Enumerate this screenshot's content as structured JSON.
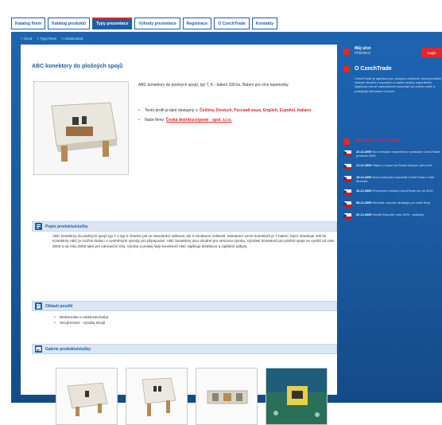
{
  "nav": {
    "tabs": [
      {
        "label": "Katalog firem",
        "active": false
      },
      {
        "label": "Katalog produktů",
        "active": false
      },
      {
        "label": "Typy prezentace",
        "active": true
      },
      {
        "label": "Výhody prezentace",
        "active": false
      },
      {
        "label": "Registrace",
        "active": false
      },
      {
        "label": "O CzechTrade",
        "active": false
      },
      {
        "label": "Kontakty",
        "active": false
      }
    ]
  },
  "breadcrumb": [
    "> Úvod",
    "> Typy firem",
    "> Instalovaná"
  ],
  "product": {
    "title": "ABC konektory do plošných spojů",
    "intro": "ABC konektory do plošných spojů, typ T, K - balení 100 ks, Balení pro více tepelnotky.",
    "lang_label": "Tento profil je také dostupný v:",
    "languages": "Čeština, Deutsch, Pусский язык, English, Español, Italiano",
    "web_label": "Naše firmy:",
    "web_link": "Česká distribuce/pewe - spol. s.r.o."
  },
  "sections": {
    "about": "Popis produktu/služby",
    "uses": "Oblasti použití",
    "gallery": "Galerie produktu/služby"
  },
  "about_text": "ABC konektory do plošných spojů typ T a typ K vhodné jak ve standardní velikosti, tak s miniaturní velikostí. Miniaturní verze konektorů je T balení, které obsahuje 100 ks. Konektory ABC je možné dodat i s uvolněnými vývody pro připojování. ABC konektory jsou vhodné pro sériovou výrobu. Výrobek konektorů pro plošné spoje se vyrábí od roku 2003 a od roku 2005 také pro zahraniční trhy. Výroba a prodej řady konektorů ABC zajišťuje distribuce a zajištění odbytu.",
  "uses": [
    "Elektronika a elektrotechnika",
    "Strojírenství - výroba strojů"
  ],
  "sidebar": {
    "account_title": "Můj účet",
    "account_sub": "Přihlášení",
    "login": "Login",
    "about_heading": "O CzechTrade",
    "about_text": "CzechTrade je agentura pro podporu obchodu, která pomáhá českým firmám s exportem a nabízí služby exportérům. Agentura má síť zahraničních kanceláří po celém světě a poskytuje informace o trzích.",
    "news_heading": "Aktuality CzechTrade",
    "news": [
      {
        "date": "22.12.2009",
        "text": "Kurz českých exportérů ve zprávách CzechTrade prosinec 2009"
      },
      {
        "date": "21.12.2009",
        "text": "Zájem o export do Ruska stoupá i přes krizi"
      },
      {
        "date": "15.12.2009",
        "text": "Nová zahraniční kancelář CzechTrade v Indii - Mumbai"
      },
      {
        "date": "10.12.2009",
        "text": "Proexportní služby CzechTrade na rok 2010"
      },
      {
        "date": "08.12.2009",
        "text": "Seminář: exportní strategie pro malé firmy"
      },
      {
        "date": "02.12.2009",
        "text": "Soutěž Exportér roku 2009 - výsledky"
      }
    ]
  },
  "colors": {
    "brand_blue": "#1b5fa8",
    "accent_red": "#e3262c"
  }
}
